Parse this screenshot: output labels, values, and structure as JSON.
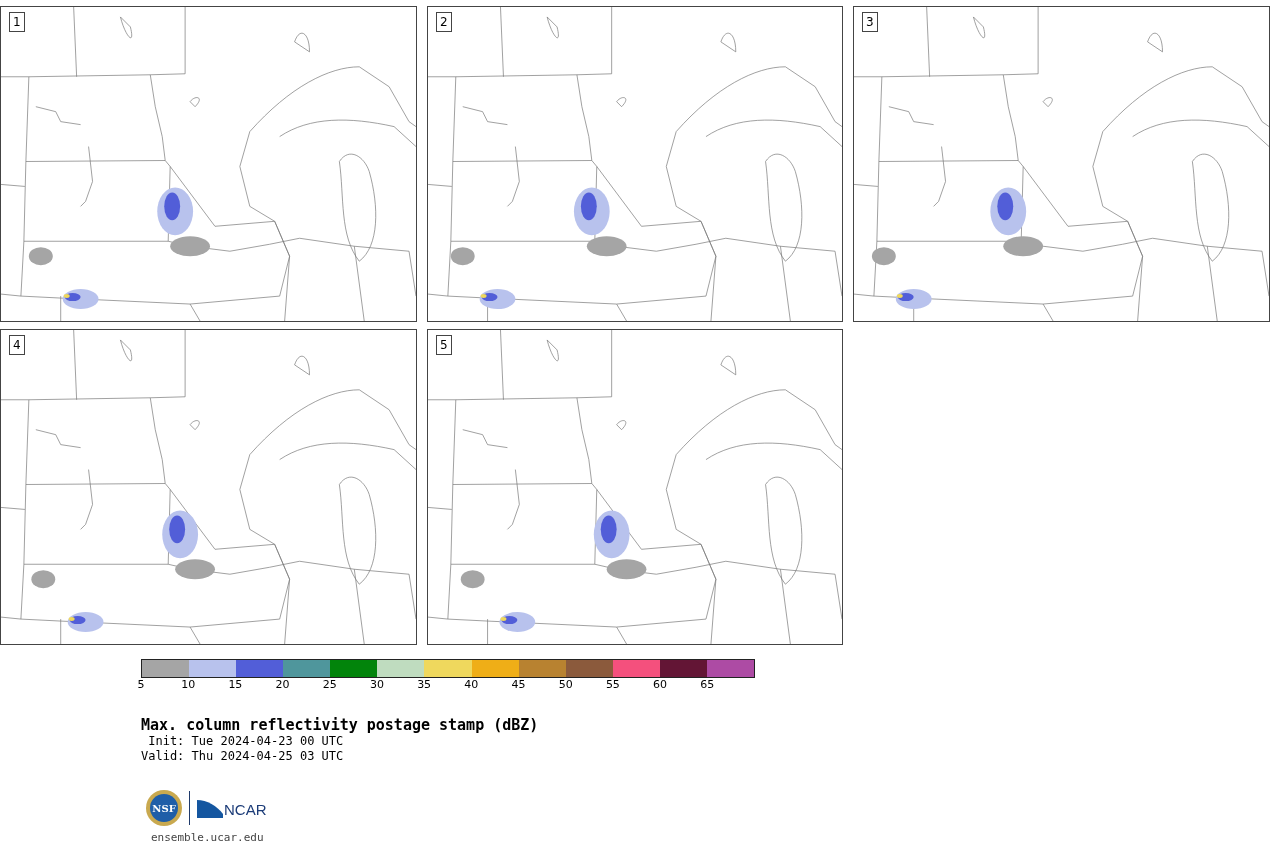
{
  "panels": [
    {
      "label": "1"
    },
    {
      "label": "2"
    },
    {
      "label": "3"
    },
    {
      "label": "4"
    },
    {
      "label": "5"
    }
  ],
  "colorbar": {
    "segments": [
      {
        "color": "#a5a5a5"
      },
      {
        "color": "#b8c2ed"
      },
      {
        "color": "#525ed8"
      },
      {
        "color": "#4f969c"
      },
      {
        "color": "#02840b"
      },
      {
        "color": "#bfdcbf"
      },
      {
        "color": "#efd85d"
      },
      {
        "color": "#efae17"
      },
      {
        "color": "#b88230"
      },
      {
        "color": "#8b5a3c"
      },
      {
        "color": "#f4507d"
      },
      {
        "color": "#631535"
      },
      {
        "color": "#ad4ba4"
      }
    ],
    "ticks": [
      "5",
      "10",
      "15",
      "20",
      "25",
      "30",
      "35",
      "40",
      "45",
      "50",
      "55",
      "60",
      "65"
    ]
  },
  "title": "Max. column reflectivity postage stamp (dBZ)",
  "init": " Init: Tue 2024-04-23 00 UTC",
  "valid": "Valid: Thu 2024-04-25 03 UTC",
  "logo": {
    "nsf": "NSF",
    "ncar": "NCAR"
  },
  "url": "ensemble.ucar.edu"
}
